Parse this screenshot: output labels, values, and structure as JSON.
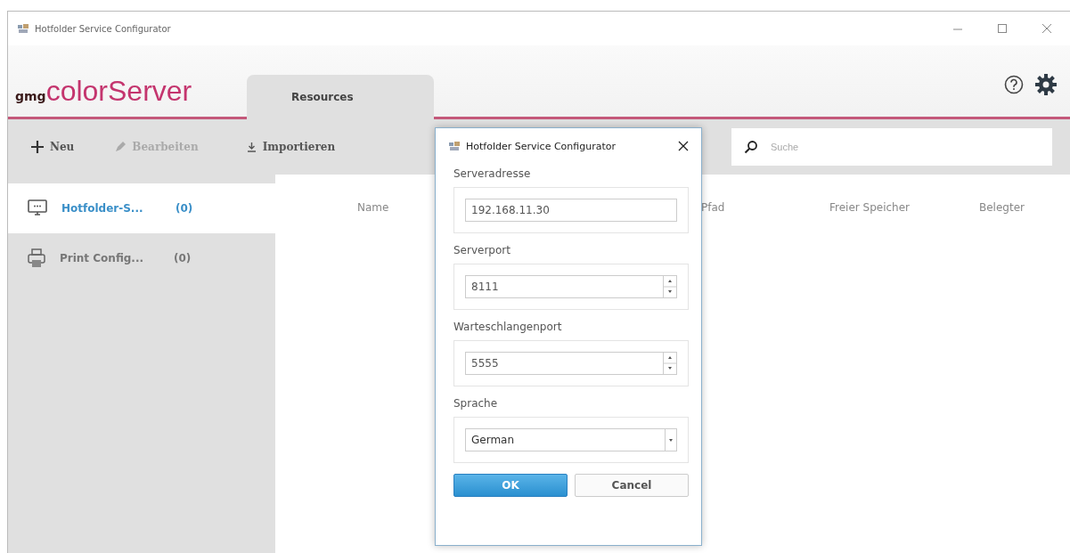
{
  "window": {
    "title": "Hotfolder Service Configurator"
  },
  "logo": {
    "prefix": "gmg",
    "name": "colorServer"
  },
  "tabs": [
    {
      "label": "Resources",
      "selected": true
    }
  ],
  "toolbar": [
    {
      "label": "Neu",
      "kind": "add",
      "disabled": false
    },
    {
      "label": "Bearbeiten",
      "kind": "edit",
      "disabled": true
    },
    {
      "label": "Importieren",
      "kind": "import",
      "disabled": false
    }
  ],
  "search": {
    "placeholder": "Suche"
  },
  "sidebar": {
    "items": [
      {
        "label": "Hotfolder-S...",
        "count": "(0)",
        "kind": "monitor",
        "selected": true
      },
      {
        "label": "Print Config...",
        "count": "(0)",
        "kind": "printer",
        "selected": false
      }
    ]
  },
  "table": {
    "columns": [
      "Name",
      "Pfad",
      "Freier Speicher",
      "Belegter"
    ]
  },
  "dialog": {
    "title": "Hotfolder Service Configurator",
    "fields": [
      {
        "label": "Serveradresse",
        "value": "192.168.11.30",
        "kind": "text"
      },
      {
        "label": "Serverport",
        "value": "8111",
        "kind": "spin"
      },
      {
        "label": "Warteschlangenport",
        "value": "5555",
        "kind": "spin"
      },
      {
        "label": "Sprache",
        "value": "German",
        "kind": "select"
      }
    ],
    "buttons": [
      {
        "label": "OK",
        "kind": "primary"
      },
      {
        "label": "Cancel",
        "kind": "secondary"
      }
    ]
  }
}
